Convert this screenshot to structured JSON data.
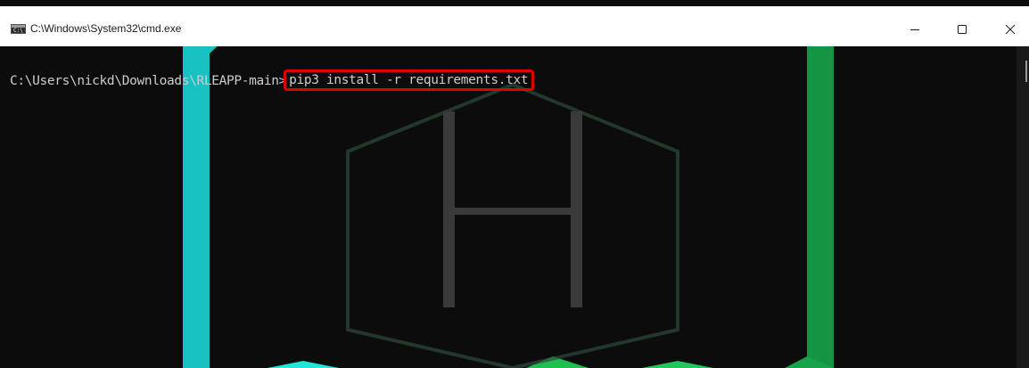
{
  "window": {
    "title": "C:\\Windows\\System32\\cmd.exe",
    "icon_label": "C:\\",
    "controls": {
      "minimize": "minimize-icon",
      "maximize": "maximize-icon",
      "close": "close-icon"
    }
  },
  "console": {
    "prompt": "C:\\Users\\nickd\\Downloads\\RLEAPP-main>",
    "command": "pip3 install -r requirements.txt",
    "text_color": "#cccccc",
    "background": "#0c0c0c",
    "highlight_color": "#e00000"
  },
  "colors": {
    "accent_green": "#22c55e",
    "accent_cyan": "#22d3ee"
  }
}
